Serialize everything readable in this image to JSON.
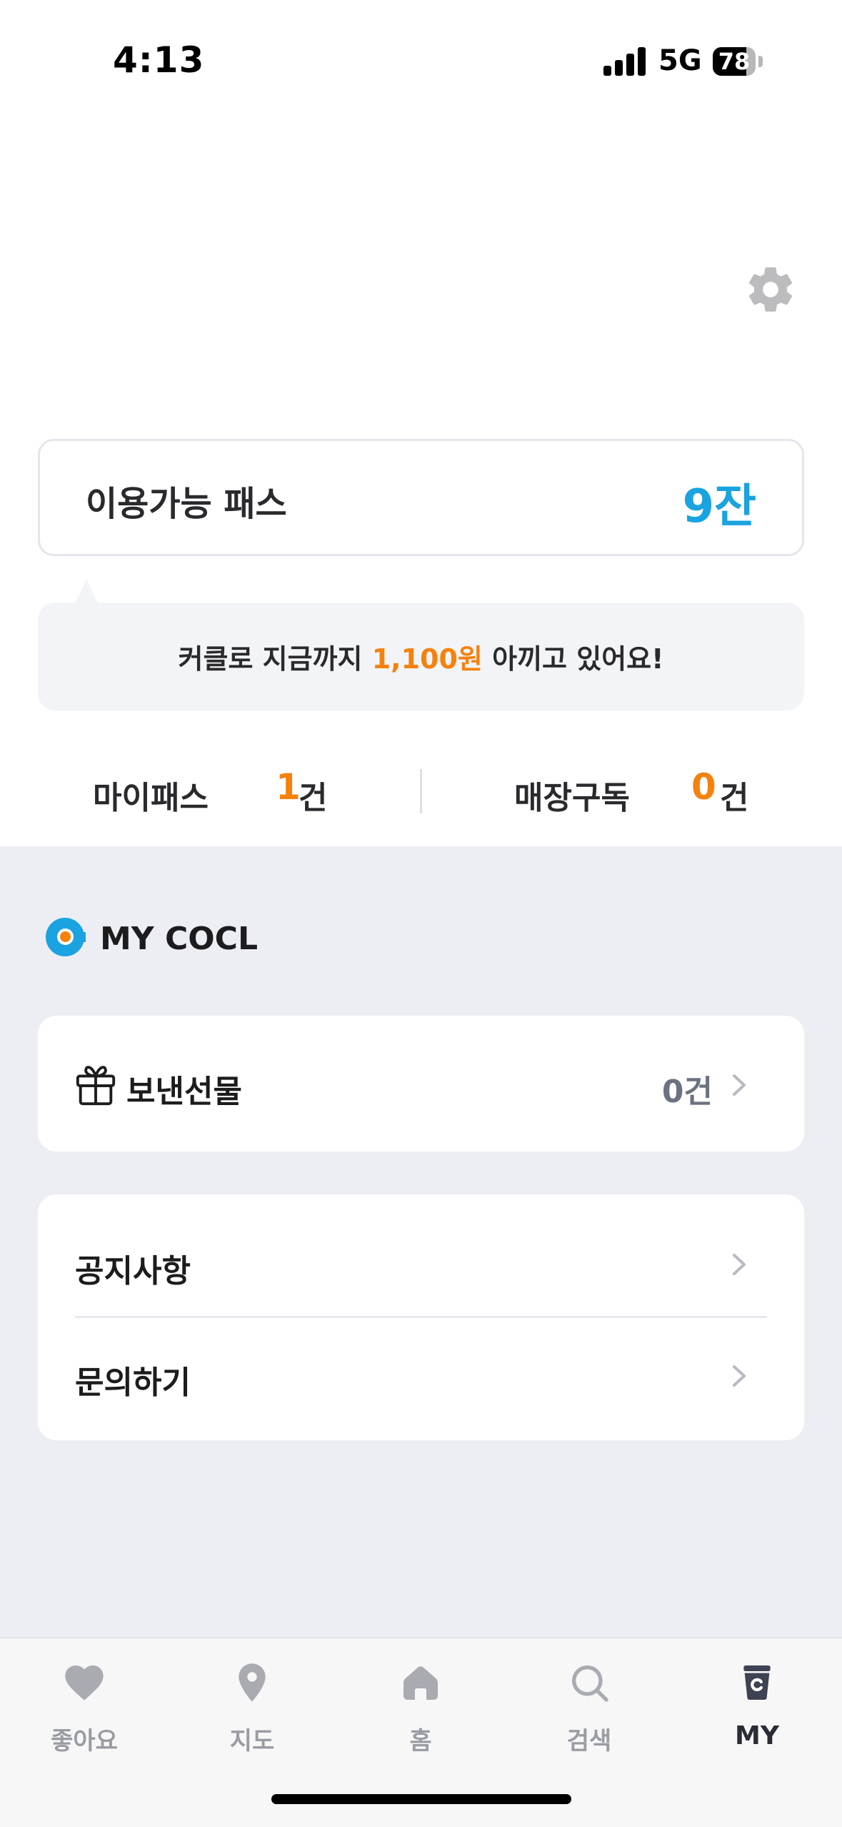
{
  "status_bar": {
    "time": "4:13",
    "network": "5G",
    "battery": "78",
    "battery_level": 0.78
  },
  "header": {
    "settings_icon": "gear-icon"
  },
  "pass_card": {
    "label": "이용가능 패스",
    "value": "9잔",
    "value_color": "#1aa3e0"
  },
  "savings": {
    "prefix": "커클로 지금까지 ",
    "amount": "1,100원",
    "suffix": " 아끼고 있어요!",
    "amount_color": "#f5820d"
  },
  "counts": {
    "mypass_label": "마이패스",
    "mypass_value": "1",
    "mypass_unit": "건",
    "store_label": "매장구독",
    "store_value": "0",
    "store_unit": "건"
  },
  "my_cocl": {
    "title": "MY COCL",
    "gift": {
      "label": "보낸선물",
      "count": "0건",
      "icon": "gift-icon"
    },
    "menu": [
      {
        "label": "공지사항"
      },
      {
        "label": "문의하기"
      }
    ]
  },
  "tab_bar": {
    "tabs": [
      {
        "label": "좋아요",
        "icon": "heart-icon"
      },
      {
        "label": "지도",
        "icon": "map-pin-icon"
      },
      {
        "label": "홈",
        "icon": "home-icon"
      },
      {
        "label": "검색",
        "icon": "search-icon"
      },
      {
        "label": "MY",
        "icon": "cup-icon",
        "active": true
      }
    ]
  },
  "colors": {
    "accent_blue": "#1aa3e0",
    "accent_orange": "#f5820d",
    "section_bg": "#eceef4"
  }
}
